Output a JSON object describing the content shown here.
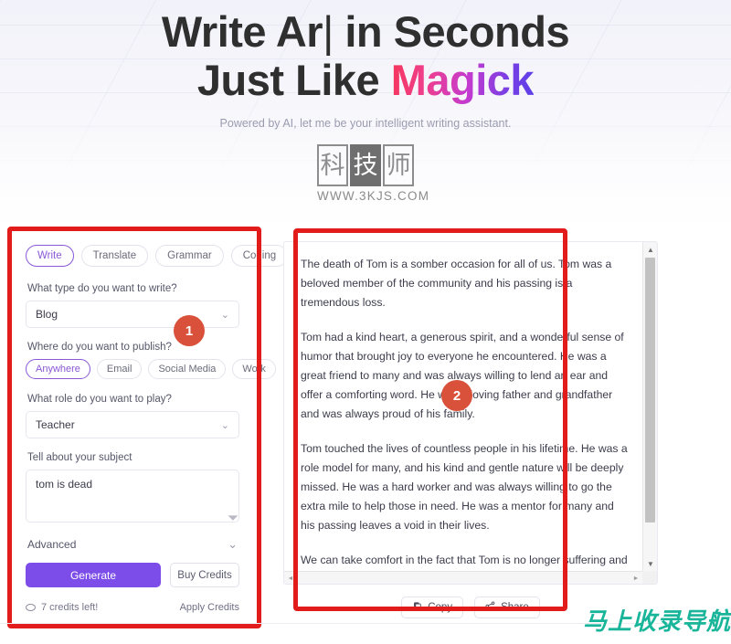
{
  "hero": {
    "headline_line1_a": "Write Ar",
    "headline_cursor": "|",
    "headline_line1_b": " in Seconds",
    "headline_line2_a": "Just Like ",
    "headline_line2_magick": "Magick",
    "subtitle": "Powered by AI, let me be your intelligent writing assistant.",
    "accent_pink": "#f5365c",
    "accent_violet": "#5b3fe8"
  },
  "logo": {
    "char1": "科",
    "char2": "技",
    "char3": "师",
    "url": "WWW.3KJS.COM"
  },
  "left_panel": {
    "mode_tabs": [
      {
        "label": "Write",
        "active": true
      },
      {
        "label": "Translate",
        "active": false
      },
      {
        "label": "Grammar",
        "active": false
      },
      {
        "label": "Coding",
        "active": false
      }
    ],
    "type_label": "What type do you want to write?",
    "type_value": "Blog",
    "publish_label": "Where do you want to publish?",
    "publish_chips": [
      {
        "label": "Anywhere",
        "active": true
      },
      {
        "label": "Email",
        "active": false
      },
      {
        "label": "Social Media",
        "active": false
      },
      {
        "label": "Work",
        "active": false
      }
    ],
    "role_label": "What role do you want to play?",
    "role_value": "Teacher",
    "subject_label": "Tell about your subject",
    "subject_value": "tom is dead",
    "subject_placeholder": "Tell about your subject",
    "advanced_label": "Advanced",
    "generate_label": "Generate",
    "buy_credits_label": "Buy Credits",
    "credits_text": "7 credits left!",
    "apply_credits_label": "Apply Credits",
    "chevron": "⌄",
    "accent_purple": "#7c4de8"
  },
  "right_panel": {
    "paragraphs": [
      "The death of Tom is a somber occasion for all of us. Tom was a beloved member of the community and his passing is a tremendous loss.",
      "Tom had a kind heart, a generous spirit, and a wonderful sense of humor that brought joy to everyone he encountered. He was a great friend to many and was always willing to lend an ear and offer a comforting word. He was a loving father and grandfather and was always proud of his family.",
      "Tom touched the lives of countless people in his lifetime. He was a role model for many, and his kind and gentle nature will be deeply missed. He was a hard worker and was always willing to go the extra mile to help those in need. He was a mentor for many and his passing leaves a void in their lives.",
      "We can take comfort in the fact that Tom is no longer suffering and is now in a better place. We should take solace in the fact that he is no longer in pain and can now rest peacefully."
    ],
    "copy_label": "Copy",
    "share_label": "Share",
    "scroll_up": "▲",
    "scroll_down": "▼",
    "scroll_left": "◄",
    "scroll_right": "►"
  },
  "annotations": {
    "badge_1": "1",
    "badge_2": "2",
    "box_color": "#e21b1b",
    "badge_color": "#d9513a"
  },
  "watermarks": {
    "bottom_right": "马上收录导航",
    "bottom_right_color": "#19b59a"
  }
}
